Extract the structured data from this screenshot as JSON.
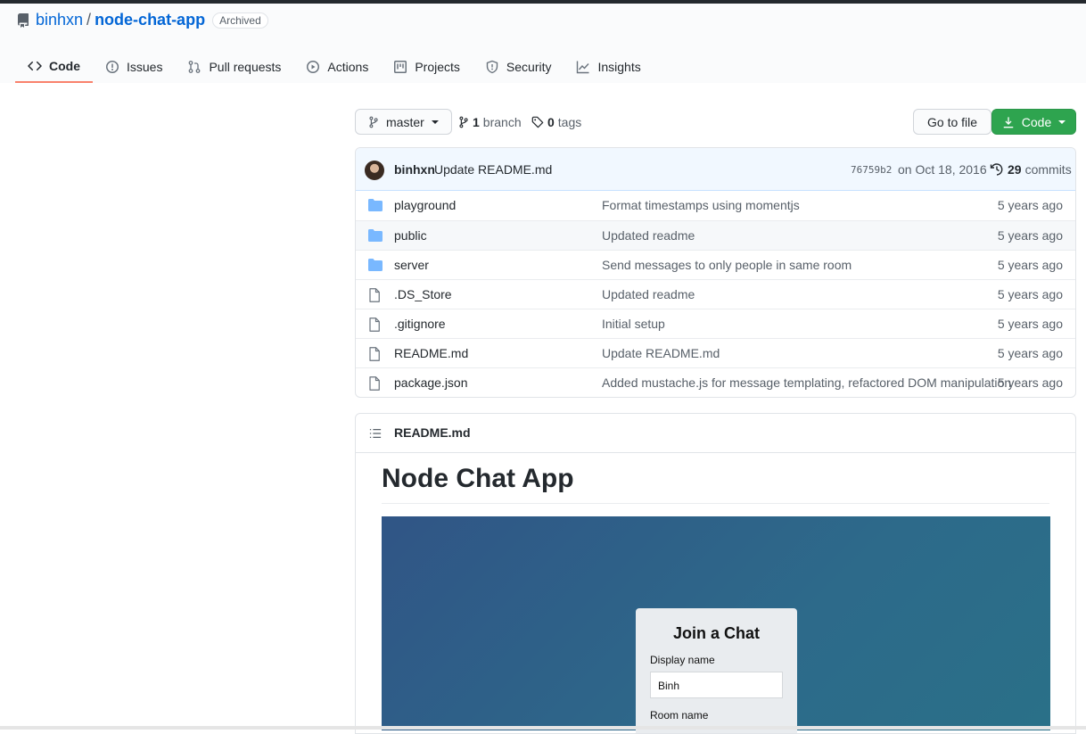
{
  "repo": {
    "owner": "binhxn",
    "separator": "/",
    "name": "node-chat-app",
    "badge": "Archived"
  },
  "tabs": [
    {
      "label": "Code",
      "icon": "code-icon",
      "selected": true
    },
    {
      "label": "Issues",
      "icon": "issue-icon"
    },
    {
      "label": "Pull requests",
      "icon": "pull-request-icon"
    },
    {
      "label": "Actions",
      "icon": "play-icon"
    },
    {
      "label": "Projects",
      "icon": "project-icon"
    },
    {
      "label": "Security",
      "icon": "shield-icon"
    },
    {
      "label": "Insights",
      "icon": "graph-icon"
    }
  ],
  "toolbar": {
    "branch": "master",
    "branch_count": "1",
    "branch_label": "branch",
    "tag_count": "0",
    "tag_label": "tags",
    "goto_label": "Go to file",
    "code_label": "Code"
  },
  "commit": {
    "author": "binhxn",
    "message": "Update README.md",
    "sha": "76759b2",
    "date": "on Oct 18, 2016",
    "count": "29",
    "count_label": "commits"
  },
  "files": [
    {
      "type": "folder",
      "name": "playground",
      "message": "Format timestamps using momentjs",
      "age": "5 years ago"
    },
    {
      "type": "folder",
      "name": "public",
      "message": "Updated readme",
      "age": "5 years ago"
    },
    {
      "type": "folder",
      "name": "server",
      "message": "Send messages to only people in same room",
      "age": "5 years ago"
    },
    {
      "type": "file",
      "name": ".DS_Store",
      "message": "Updated readme",
      "age": "5 years ago"
    },
    {
      "type": "file",
      "name": ".gitignore",
      "message": "Initial setup",
      "age": "5 years ago"
    },
    {
      "type": "file",
      "name": "README.md",
      "message": "Update README.md",
      "age": "5 years ago"
    },
    {
      "type": "file",
      "name": "package.json",
      "message": "Added mustache.js for message templating, refactored DOM manipulation",
      "age": "5 years ago"
    }
  ],
  "readme": {
    "filename": "README.md",
    "heading": "Node Chat App",
    "screenshot": {
      "title": "Join a Chat",
      "display_label": "Display name",
      "display_value": "Binh",
      "room_label": "Room name"
    }
  },
  "colors": {
    "link": "#0366d6",
    "code_button": "#2ea44f",
    "selected_tab_underline": "#f9826c",
    "folder": "#79b8ff"
  }
}
